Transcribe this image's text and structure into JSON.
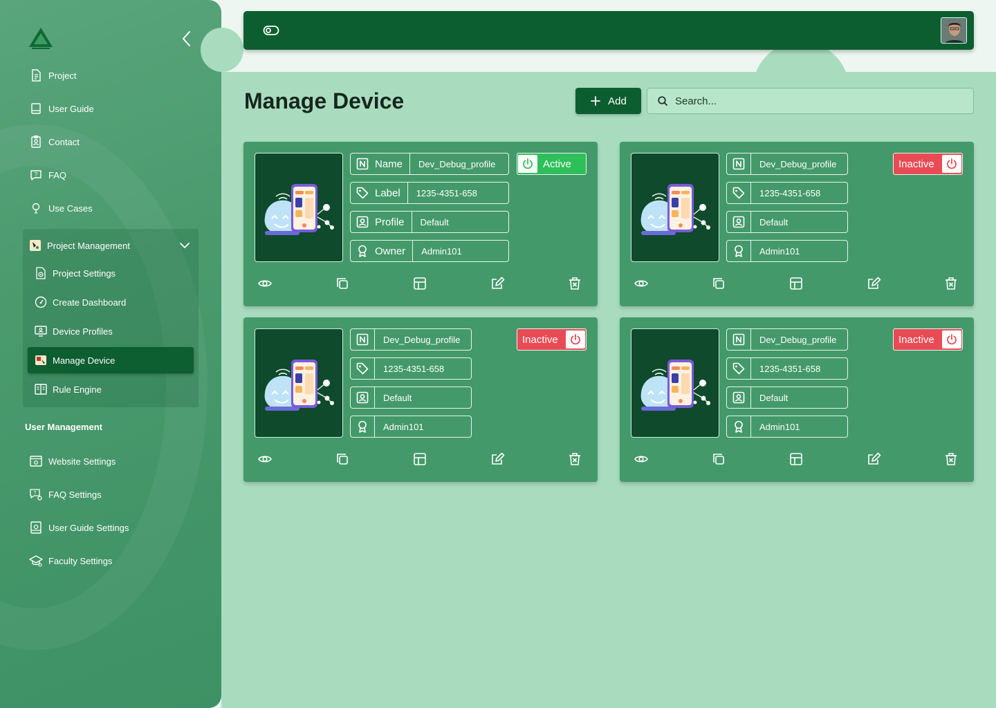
{
  "sidebar": {
    "nav": [
      {
        "label": "Project",
        "icon": "document-icon"
      },
      {
        "label": "User Guide",
        "icon": "book-icon"
      },
      {
        "label": "Contact",
        "icon": "contact-badge-icon"
      },
      {
        "label": "FAQ",
        "icon": "question-chat-icon"
      },
      {
        "label": "Use Cases",
        "icon": "lightbulb-icon"
      }
    ],
    "project_management": {
      "label": "Project Management",
      "items": [
        {
          "label": "Project Settings",
          "icon": "settings-document-icon"
        },
        {
          "label": "Create Dashboard",
          "icon": "dashboard-gauge-icon"
        },
        {
          "label": "Device Profiles",
          "icon": "monitor-profile-icon"
        },
        {
          "label": "Manage Device",
          "icon": "manage-device-icon",
          "active": true
        },
        {
          "label": "Rule Engine",
          "icon": "rule-book-icon"
        }
      ]
    },
    "user_management": {
      "label": "User Management",
      "items": [
        {
          "label": "Website Settings",
          "icon": "website-settings-icon"
        },
        {
          "label": "FAQ Settings",
          "icon": "faq-settings-icon"
        },
        {
          "label": "User Guide Settings",
          "icon": "guide-settings-icon"
        },
        {
          "label": "Faculty Settings",
          "icon": "graduation-cap-icon"
        }
      ]
    }
  },
  "header": {
    "title": "Manage Device",
    "add_label": "Add",
    "search_placeholder": "Search..."
  },
  "colors": {
    "primary": "#0c5e31",
    "card": "#44996a",
    "active": "#2fbf5a",
    "inactive": "#e94b55"
  },
  "devices": [
    {
      "show_keys": true,
      "name_key": "Name",
      "name": "Dev_Debug_profile",
      "label_key": "Label",
      "label": "1235-4351-658",
      "profile_key": "Profile",
      "profile": "Default",
      "owner_key": "Owner",
      "owner": "Admin101",
      "status": "Active"
    },
    {
      "show_keys": false,
      "name": "Dev_Debug_profile",
      "label": "1235-4351-658",
      "profile": "Default",
      "owner": "Admin101",
      "status": "Inactive"
    },
    {
      "show_keys": false,
      "name": "Dev_Debug_profile",
      "label": "1235-4351-658",
      "profile": "Default",
      "owner": "Admin101",
      "status": "Inactive"
    },
    {
      "show_keys": false,
      "name": "Dev_Debug_profile",
      "label": "1235-4351-658",
      "profile": "Default",
      "owner": "Admin101",
      "status": "Inactive"
    }
  ]
}
